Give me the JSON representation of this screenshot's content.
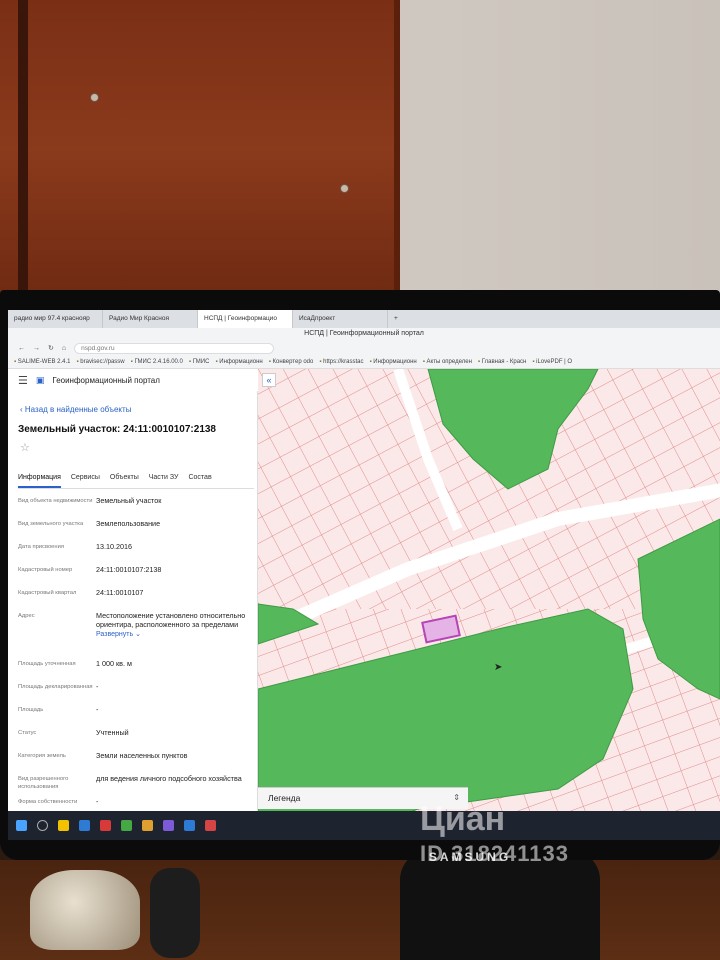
{
  "browser": {
    "tabs": [
      {
        "label": "радио мир 97.4 краснояр"
      },
      {
        "label": "Радио Мир Красноя"
      },
      {
        "label": "НСПД | Геоинформацио"
      },
      {
        "label": "ИсаДпроект"
      }
    ],
    "window_title": "НСПД | Геоинформационный портал",
    "address": "nspd.gov.ru",
    "bookmarks": [
      "SALIME-WEB 2.4.1",
      "bravisec://passw",
      "ГМИС 2.4.16.00.0",
      "ГМИС",
      "Информационн",
      "Конвертер odo",
      "https://krasstac",
      "Информационн",
      "Акты определен",
      "Главная - Красн",
      "iLovePDF | О"
    ]
  },
  "app": {
    "title": "Геоинформационный портал"
  },
  "panel": {
    "back_link": "Назад в найденные объекты",
    "object_title": "Земельный участок: 24:11:0010107:2138",
    "tabs": [
      "Информация",
      "Сервисы",
      "Объекты",
      "Части ЗУ",
      "Состав"
    ],
    "properties": [
      {
        "key": "Вид объекта недвижимости",
        "value": "Земельный участок"
      },
      {
        "key": "Вид земельного участка",
        "value": "Землепользование"
      },
      {
        "key": "Дата присвоения",
        "value": "13.10.2016"
      },
      {
        "key": "Кадастровый номер",
        "value": "24:11:0010107:2138"
      },
      {
        "key": "Кадастровый квартал",
        "value": "24:11:0010107"
      },
      {
        "key": "Адрес",
        "value": "Местоположение установлено относительно ориентира, расположенного за пределами"
      },
      {
        "key": "Площадь уточненная",
        "value": "1 000 кв. м"
      },
      {
        "key": "Площадь декларированная",
        "value": "-"
      },
      {
        "key": "Площадь",
        "value": "-"
      },
      {
        "key": "Статус",
        "value": "Учтенный"
      },
      {
        "key": "Категория земель",
        "value": "Земли населенных пунктов"
      },
      {
        "key": "Вид разрешенного использования",
        "value": "для ведения личного подсобного хозяйства"
      },
      {
        "key": "Форма собственности",
        "value": "-"
      }
    ],
    "expand_label": "Развернуть"
  },
  "map": {
    "legend_label": "Легенда",
    "colors": {
      "background": "#fbe9e9",
      "parcel_line": "#e28a8a",
      "green_zone": "#55b85a",
      "selected_parcel": "#e6b3e6",
      "road": "#ffffff"
    }
  },
  "monitor": {
    "brand": "SAMSUNG"
  },
  "watermark": {
    "name": "Циан",
    "id": "ID 318241133"
  }
}
